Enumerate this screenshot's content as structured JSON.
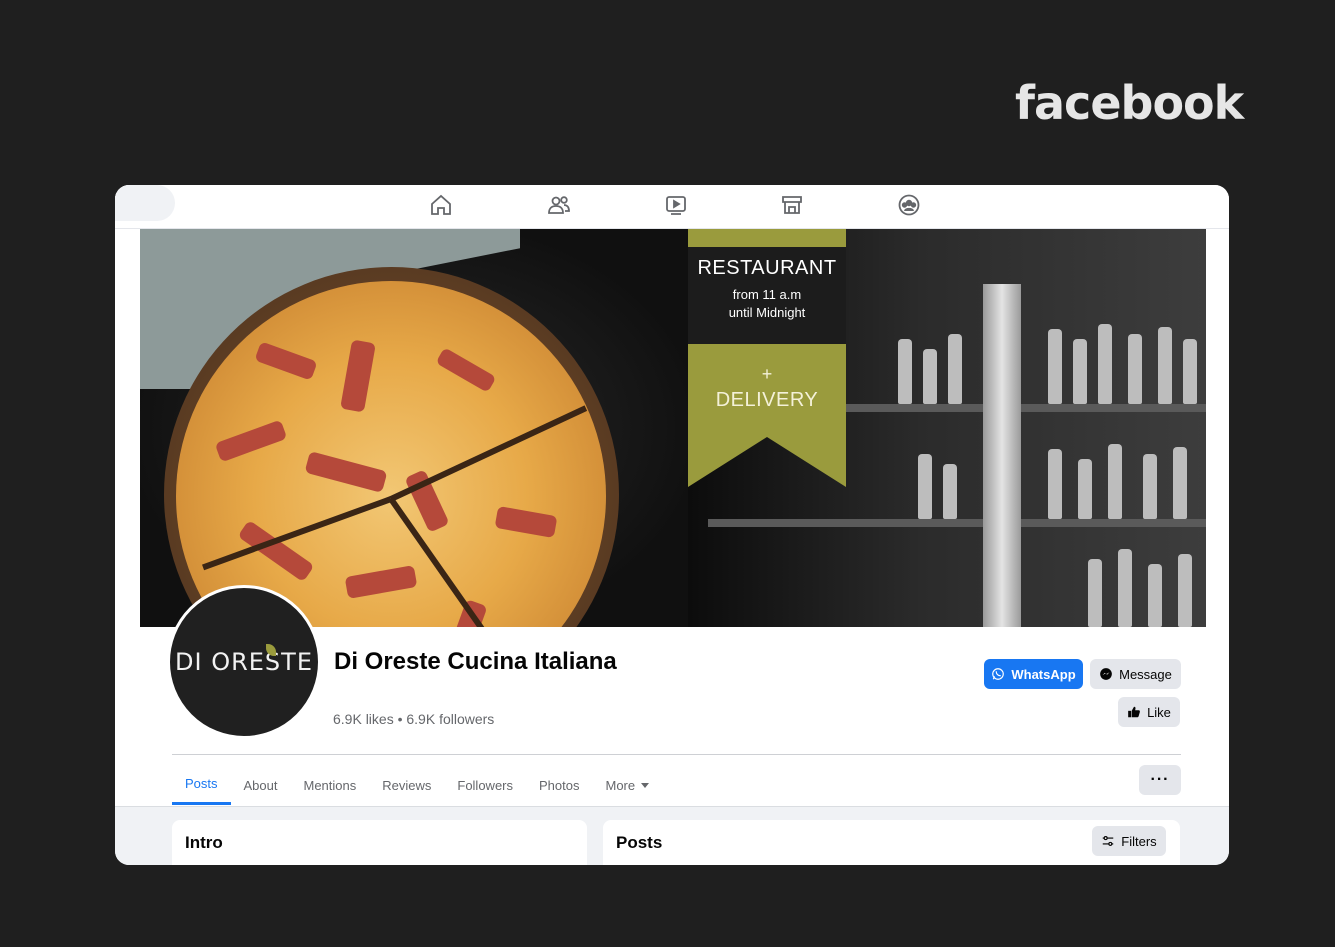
{
  "brand": {
    "wordmark": "facebook"
  },
  "top_nav": {
    "icons": [
      "home-icon",
      "friends-icon",
      "video-icon",
      "marketplace-icon",
      "groups-icon"
    ]
  },
  "cover": {
    "banner_title": "RESTAURANT",
    "banner_hours_line1": "from 11 a.m",
    "banner_hours_line2": "until Midnight",
    "banner_plus": "+",
    "banner_delivery": "DELIVERY",
    "accent_color": "#9a9b3d"
  },
  "profile": {
    "avatar_text": "DI ORESTE",
    "name": "Di Oreste Cucina Italiana",
    "stats": "6.9K likes • 6.9K followers"
  },
  "actions": {
    "whatsapp_label": "WhatsApp",
    "message_label": "Message",
    "like_label": "Like"
  },
  "tabs": [
    {
      "label": "Posts",
      "active": true
    },
    {
      "label": "About",
      "active": false
    },
    {
      "label": "Mentions",
      "active": false
    },
    {
      "label": "Reviews",
      "active": false
    },
    {
      "label": "Followers",
      "active": false
    },
    {
      "label": "Photos",
      "active": false
    },
    {
      "label": "More",
      "active": false
    }
  ],
  "more_options_label": "···",
  "sections": {
    "intro_title": "Intro",
    "posts_title": "Posts",
    "filters_label": "Filters"
  },
  "colors": {
    "primary": "#1877f2",
    "background": "#1f1f1f"
  }
}
